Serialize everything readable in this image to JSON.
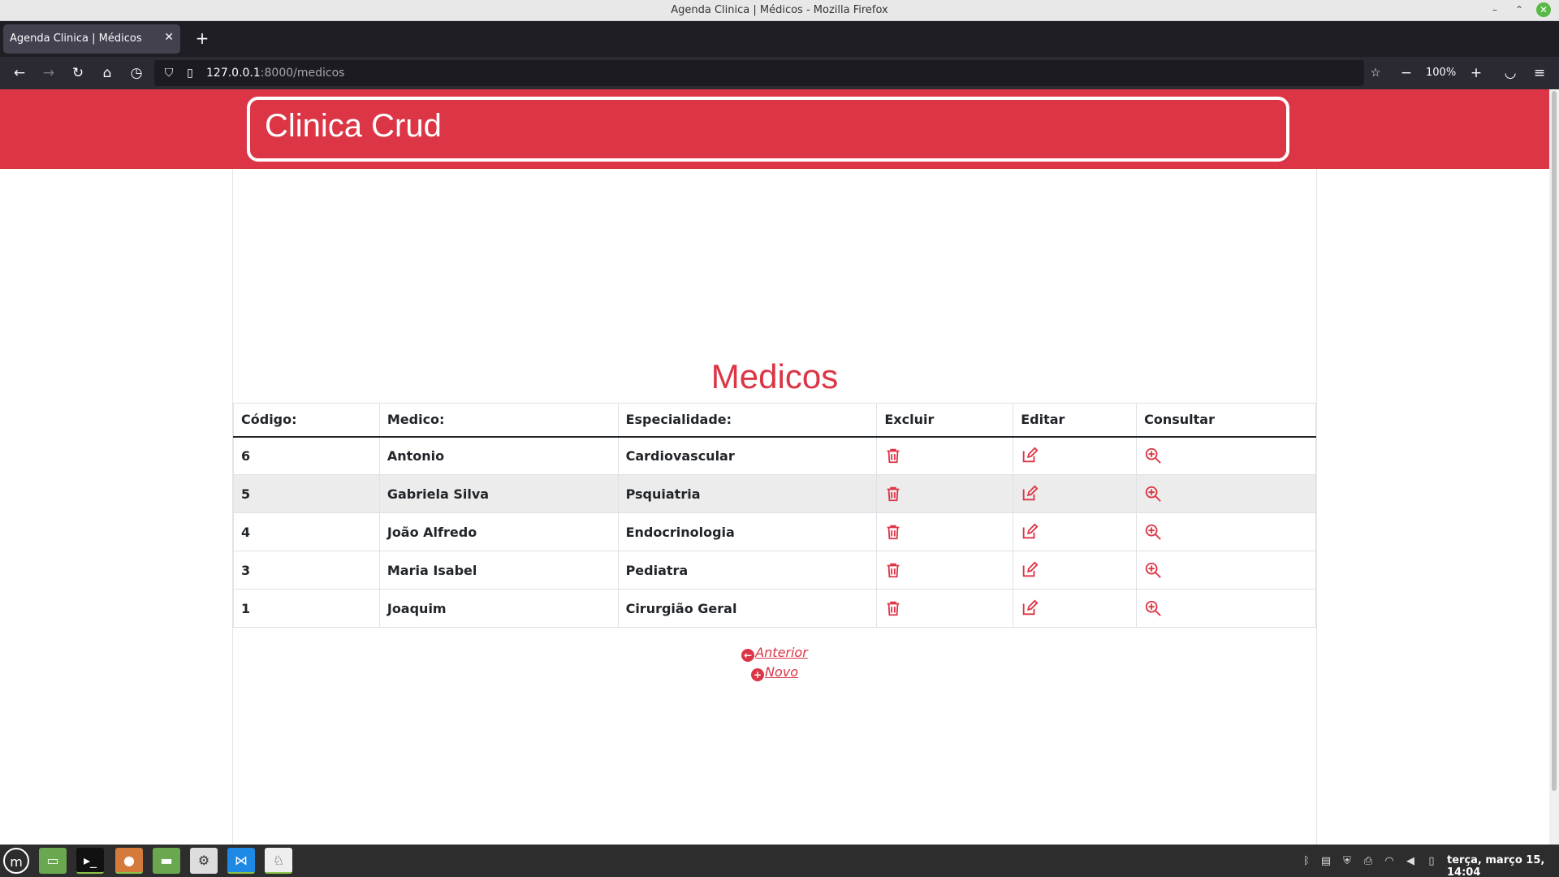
{
  "window": {
    "title": "Agenda Clinica | Médicos - Mozilla Firefox"
  },
  "browser": {
    "tab_title": "Agenda Clinica | Médicos",
    "url_host": "127.0.0.1",
    "url_path": ":8000/medicos",
    "zoom": "100%"
  },
  "site": {
    "brand": "Clinica Crud"
  },
  "page": {
    "title": "Medicos",
    "table": {
      "headers": [
        "Código:",
        "Medico:",
        "Especialidade:",
        "Excluir",
        "Editar",
        "Consultar"
      ],
      "rows": [
        {
          "codigo": "6",
          "medico": "Antonio",
          "especialidade": "Cardiovascular"
        },
        {
          "codigo": "5",
          "medico": "Gabriela Silva",
          "especialidade": "Psquiatria"
        },
        {
          "codigo": "4",
          "medico": "João Alfredo",
          "especialidade": "Endocrinologia"
        },
        {
          "codigo": "3",
          "medico": "Maria Isabel",
          "especialidade": "Pediatra"
        },
        {
          "codigo": "1",
          "medico": "Joaquim",
          "especialidade": "Cirurgião Geral"
        }
      ]
    },
    "links": {
      "anterior": "Anterior",
      "novo": "Novo"
    }
  },
  "taskbar": {
    "clock": "terça, março 15, 14:04"
  },
  "colors": {
    "accent": "#dc3545"
  },
  "icons": [
    "trash-icon",
    "edit-icon",
    "zoom-in-icon"
  ]
}
